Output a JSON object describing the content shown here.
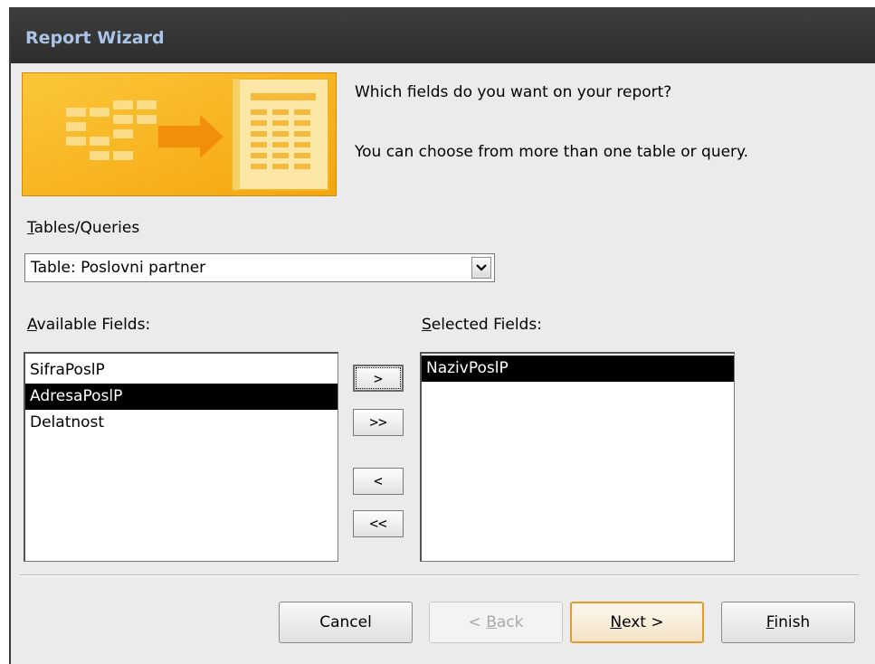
{
  "window": {
    "title": "Report Wizard"
  },
  "prompt": {
    "question": "Which fields do you want on your report?",
    "hint": "You can choose from more than one table or query."
  },
  "tables_queries": {
    "label_accel": "T",
    "label_rest": "ables/Queries",
    "selected": "Table: Poslovni partner",
    "dropdown_icon": "chevron-down-icon"
  },
  "available_fields": {
    "label_accel": "A",
    "label_rest": "vailable Fields:",
    "items": [
      {
        "label": "SifraPoslP",
        "selected": false
      },
      {
        "label": "AdresaPoslP",
        "selected": true
      },
      {
        "label": "Delatnost",
        "selected": false
      }
    ]
  },
  "selected_fields": {
    "label_accel": "S",
    "label_rest": "elected Fields:",
    "items": [
      {
        "label": "NazivPoslP",
        "selected": true
      }
    ]
  },
  "move_buttons": {
    "add_one": ">",
    "add_all": ">>",
    "remove_one": "<",
    "remove_all": "<<"
  },
  "buttons": {
    "cancel": "Cancel",
    "back_pre": "< ",
    "back_accel": "B",
    "back_rest": "ack",
    "next_accel": "N",
    "next_rest": "ext >",
    "finish_accel": "F",
    "finish_rest": "inish"
  },
  "colors": {
    "titlebar": "#2d2d2d",
    "title_text": "#a9c4e6",
    "banner": "#f9b412",
    "selection": "#000000",
    "default_button_border": "#e29a2c"
  }
}
